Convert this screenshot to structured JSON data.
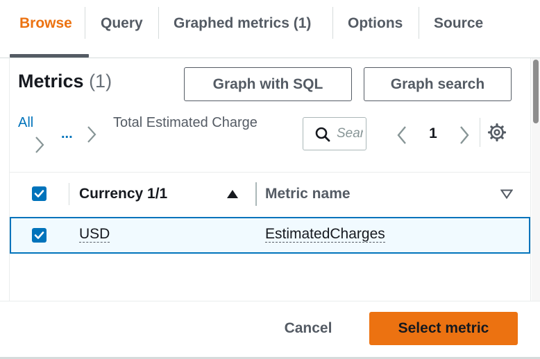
{
  "tabs": [
    {
      "label": "Browse",
      "active": true
    },
    {
      "label": "Query",
      "active": false
    },
    {
      "label": "Graphed metrics (1)",
      "active": false
    },
    {
      "label": "Options",
      "active": false
    },
    {
      "label": "Source",
      "active": false
    }
  ],
  "metrics": {
    "title": "Metrics",
    "count": "(1)",
    "graph_sql_label": "Graph with SQL",
    "graph_search_label": "Graph search"
  },
  "breadcrumb": {
    "all": "All",
    "ellipsis": "...",
    "current": "Total Estimated Charge"
  },
  "search": {
    "placeholder": "Search"
  },
  "pagination": {
    "current_page": "1"
  },
  "table": {
    "columns": [
      {
        "label": "Currency 1/1",
        "sort": "ascending"
      },
      {
        "label": "Metric name",
        "sort": "none"
      }
    ],
    "rows": [
      {
        "currency": "USD",
        "metric_name": "EstimatedCharges",
        "selected": true
      }
    ]
  },
  "footer": {
    "cancel_label": "Cancel",
    "select_label": "Select metric"
  },
  "colors": {
    "accent": "#ec7211",
    "link": "#0073bb",
    "text": "#16191f",
    "muted": "#545b64"
  }
}
